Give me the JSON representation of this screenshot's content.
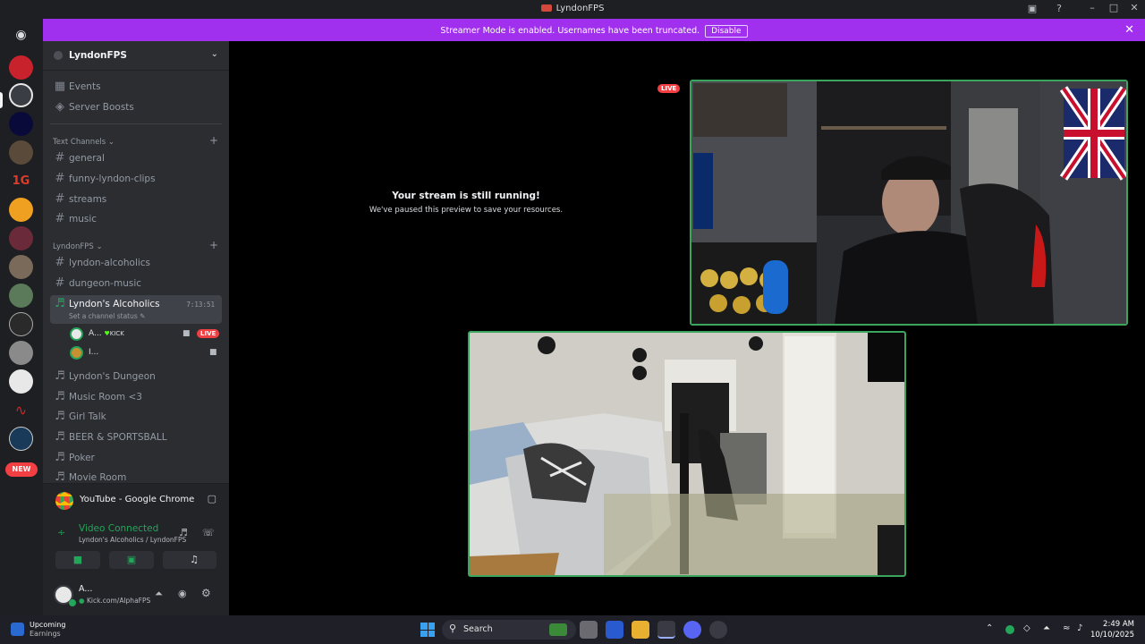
{
  "window": {
    "title": "LyndonFPS"
  },
  "banner": {
    "message": "Streamer Mode is enabled. Usernames have been truncated.",
    "disable_label": "Disable"
  },
  "guild": {
    "name": "LyndonFPS"
  },
  "top_items": [
    {
      "label": "Events",
      "icon": "calendar-icon"
    },
    {
      "label": "Server Boosts",
      "icon": "boost-icon"
    }
  ],
  "categories": {
    "text": "Text Channels",
    "lyndonfps": "LyndonFPS"
  },
  "text_channels": [
    "general",
    "funny-lyndon-clips",
    "streams",
    "music"
  ],
  "lyndonfps_channels": [
    "lyndon-alcoholics",
    "dungeon-music"
  ],
  "active_voice": {
    "name": "Lyndon's Alcoholics",
    "timer": "7:13:51",
    "status_prompt": "Set a channel status",
    "members": [
      {
        "name": "A...",
        "tag": "KICK",
        "live": "LIVE"
      },
      {
        "name": "I..."
      }
    ]
  },
  "voice_channels": [
    "Lyndon's Dungeon",
    "Music Room <3",
    "Girl Talk",
    "BEER & SPORTSBALL",
    "Poker",
    "Movie Room"
  ],
  "server_rail": {
    "new_badge": "NEW"
  },
  "activity": {
    "label": "YouTube - Google Chrome"
  },
  "voice_panel": {
    "status": "Video Connected",
    "location": "Lyndon's Alcoholics / LyndonFPS"
  },
  "user_panel": {
    "name": "A...",
    "status": "Kick.com/AlphaFPS"
  },
  "stream": {
    "live_label": "LIVE",
    "paused_title": "Your stream is still running!",
    "paused_sub": "We've paused this preview to save your resources."
  },
  "taskbar": {
    "widget_title": "Upcoming",
    "widget_sub": "Earnings",
    "search": "Search",
    "time": "2:49 AM",
    "date": "10/10/2025"
  },
  "colors": {
    "accent_purple": "#a02fee",
    "live_red": "#f23f43",
    "connected_green": "#23a55a",
    "tile_border": "#3ba55d"
  }
}
